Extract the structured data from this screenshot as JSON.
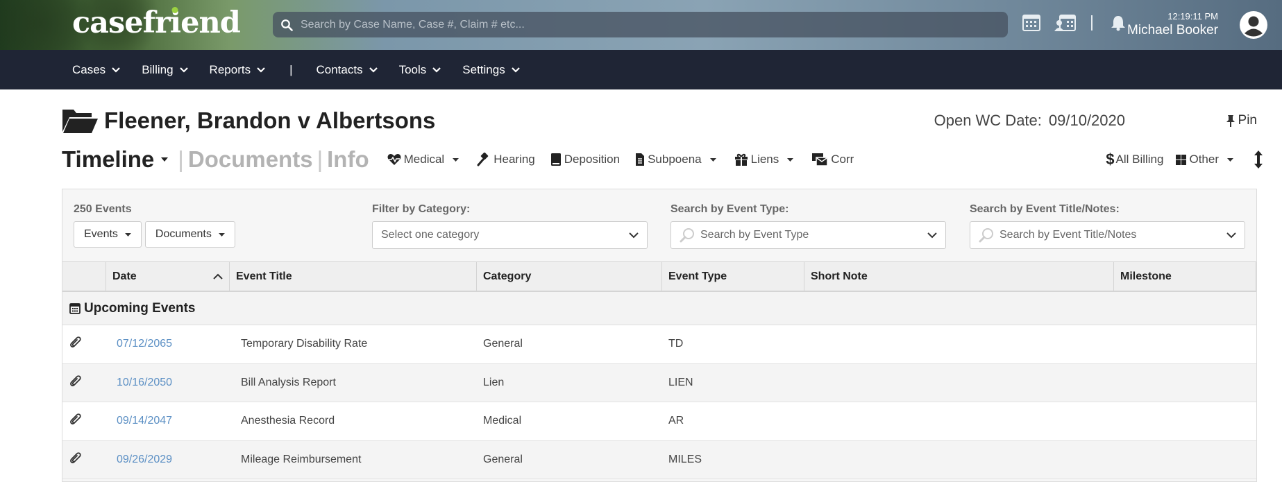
{
  "brand": {
    "logo_pre": "casefr",
    "logo_i": "i",
    "logo_post": "end"
  },
  "search": {
    "placeholder": "Search by Case Name, Case #, Claim # etc..."
  },
  "user": {
    "time": "12:19:11 PM",
    "name": "Michael Booker"
  },
  "nav": {
    "items": [
      {
        "label": "Cases"
      },
      {
        "label": "Billing"
      },
      {
        "label": "Reports"
      },
      {
        "label": "|"
      },
      {
        "label": "Contacts"
      },
      {
        "label": "Tools"
      },
      {
        "label": "Settings"
      }
    ]
  },
  "case": {
    "title": "Fleener, Brandon v Albertsons",
    "open_label": "Open WC Date:",
    "open_value": "09/10/2020",
    "pin_label": "Pin"
  },
  "tabs": {
    "timeline": "Timeline",
    "documents": "Documents",
    "info": "Info",
    "pipe": "|"
  },
  "quick_links": {
    "medical": "Medical",
    "hearing": "Hearing",
    "deposition": "Deposition",
    "subpoena": "Subpoena",
    "liens": "Liens",
    "corr": "Corr",
    "all_billing": "All Billing",
    "other": "Other"
  },
  "filters": {
    "count": "250 Events",
    "events_btn": "Events",
    "documents_btn": "Documents",
    "category_label": "Filter by Category:",
    "category_placeholder": "Select one category",
    "type_label": "Search by Event Type:",
    "type_placeholder": "Search by Event Type",
    "title_label": "Search by Event Title/Notes:",
    "title_placeholder": "Search by Event Title/Notes"
  },
  "table": {
    "headers": {
      "date": "Date",
      "title": "Event Title",
      "category": "Category",
      "type": "Event Type",
      "note": "Short Note",
      "milestone": "Milestone"
    },
    "group": "Upcoming Events",
    "rows": [
      {
        "date": "07/12/2065",
        "title": "Temporary Disability Rate",
        "category": "General",
        "type": "TD",
        "note": "",
        "milestone": ""
      },
      {
        "date": "10/16/2050",
        "title": "Bill Analysis Report",
        "category": "Lien",
        "type": "LIEN",
        "note": "",
        "milestone": ""
      },
      {
        "date": "09/14/2047",
        "title": "Anesthesia Record",
        "category": "Medical",
        "type": "AR",
        "note": "",
        "milestone": ""
      },
      {
        "date": "09/26/2029",
        "title": "Mileage Reimbursement",
        "category": "General",
        "type": "MILES",
        "note": "",
        "milestone": ""
      }
    ]
  },
  "colors": {
    "nav_bg": "#1f2535",
    "link": "#5b8fc4",
    "logo_dot": "#9bd141"
  }
}
